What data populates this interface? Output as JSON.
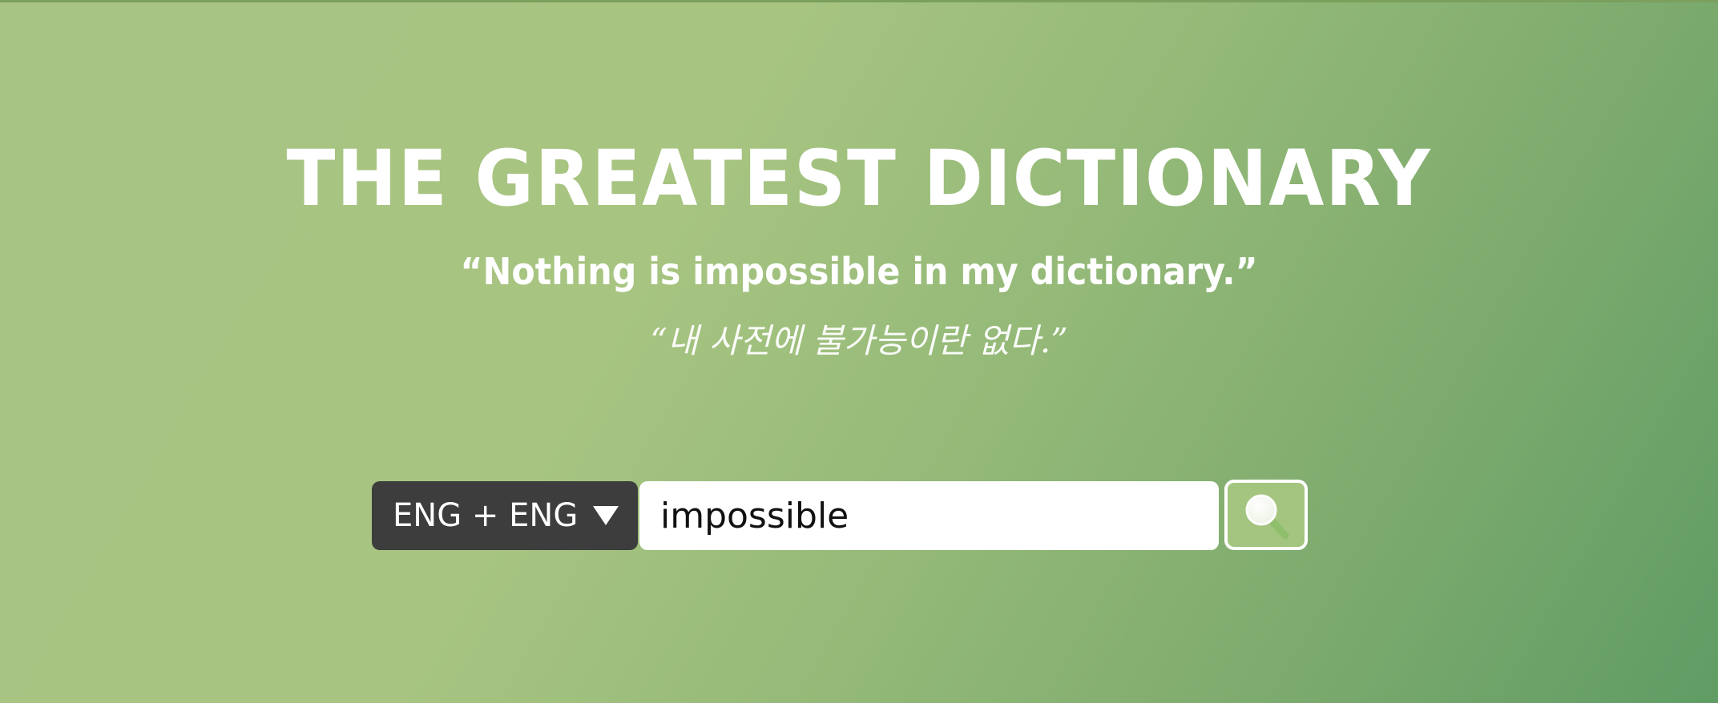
{
  "header": {
    "title": "THE GREATEST DICTIONARY",
    "quote_en": "“Nothing is impossible in my dictionary.”",
    "quote_ko": "“내 사전에 불가능이란 없다.”"
  },
  "search": {
    "language_selected": "ENG + ENG",
    "query": "impossible",
    "button_icon": "magnifier-icon"
  },
  "colors": {
    "background_start": "#a8c482",
    "background_end": "#5f9c64",
    "selector_bg": "#3d3d3d",
    "search_button_bg": "#a3c57f"
  }
}
